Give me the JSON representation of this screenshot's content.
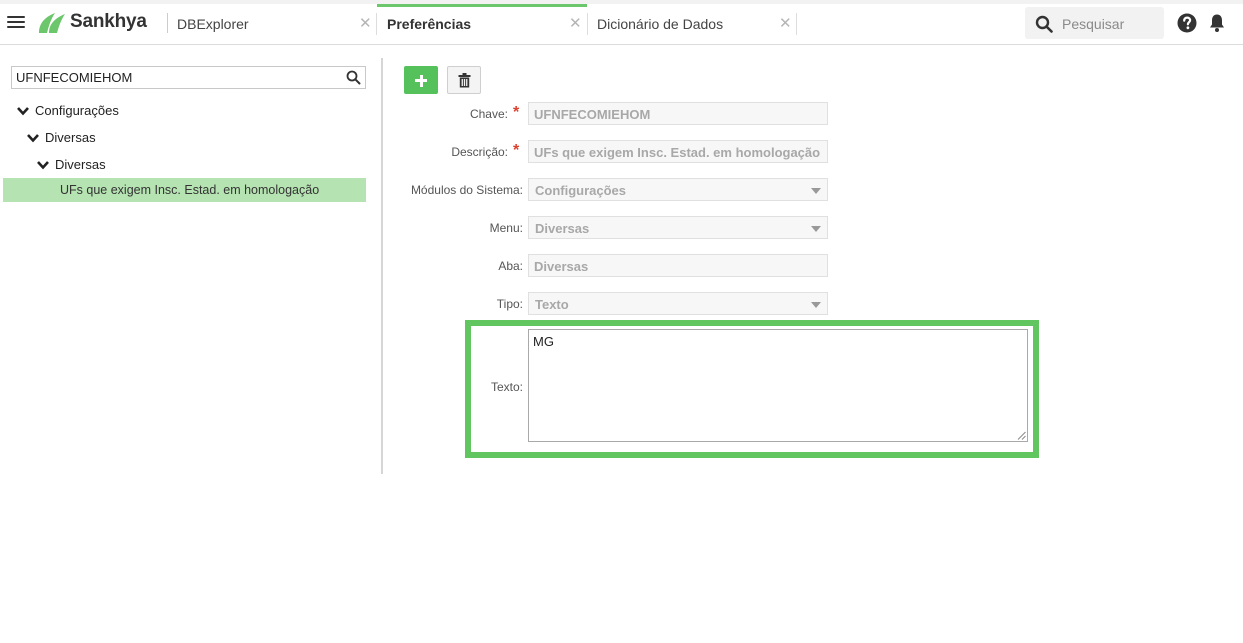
{
  "app": {
    "brand": "Sankhya",
    "accent_color": "#6cc66c"
  },
  "tabs": [
    {
      "label": "DBExplorer",
      "active": false,
      "close_icon": "close-icon"
    },
    {
      "label": "Preferências",
      "active": true,
      "close_icon": "close-icon"
    },
    {
      "label": "Dicionário de Dados",
      "active": false,
      "close_icon": "close-icon"
    }
  ],
  "header": {
    "search_placeholder": "Pesquisar",
    "icons": [
      "menu-icon",
      "search-icon",
      "help-icon",
      "bell-icon"
    ]
  },
  "sidebar": {
    "search_value": "UFNFECOMIEHOM",
    "tree": [
      {
        "label": "Configurações",
        "expanded": true,
        "level": 0
      },
      {
        "label": "Diversas",
        "expanded": true,
        "level": 1
      },
      {
        "label": "Diversas",
        "expanded": true,
        "level": 2
      },
      {
        "label": "UFs que exigem Insc. Estad. em homologação",
        "selected": true,
        "level": 3
      }
    ]
  },
  "toolbar": {
    "add_icon": "plus-icon",
    "delete_icon": "trash-icon"
  },
  "form": {
    "chave": {
      "label": "Chave:",
      "value": "UFNFECOMIEHOM",
      "required": true,
      "required_mark": "*"
    },
    "descricao": {
      "label": "Descrição:",
      "value": "UFs que exigem Insc. Estad. em homologação",
      "required": true,
      "required_mark": "*"
    },
    "modulos": {
      "label": "Módulos do Sistema:",
      "value": "Configurações"
    },
    "menu": {
      "label": "Menu:",
      "value": "Diversas"
    },
    "aba": {
      "label": "Aba:",
      "value": "Diversas"
    },
    "tipo": {
      "label": "Tipo:",
      "value": "Texto"
    },
    "texto": {
      "label": "Texto:",
      "value": "MG"
    }
  },
  "highlight_color": "#61c65f"
}
